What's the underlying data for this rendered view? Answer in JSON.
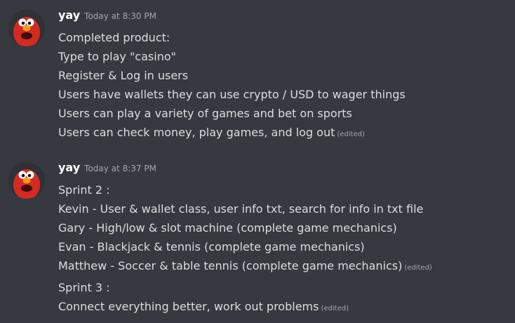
{
  "colors": {
    "background": "#36393f",
    "text": "#dcddde",
    "username": "#ffffff",
    "muted": "#a3a6aa",
    "avatar_red": "#d42a21"
  },
  "messages": [
    {
      "avatar_icon": "elmo-avatar",
      "username": "yay",
      "timestamp": "Today at 8:30 PM",
      "lines": [
        "Completed product:",
        "Type to play \"casino\"",
        "Register & Log in users",
        "Users have wallets they can use crypto / USD to wager things",
        "Users can play a variety of games and bet on sports",
        "Users can check money, play games, and log out"
      ],
      "edited_label": "(edited)"
    },
    {
      "avatar_icon": "elmo-avatar",
      "username": "yay",
      "timestamp": "Today at 8:37 PM",
      "lines": [
        "Sprint 2 :",
        "Kevin - User & wallet class, user info txt, search for info in txt file",
        "Gary - High/low & slot machine (complete game mechanics)",
        "Evan - Blackjack & tennis (complete game mechanics)",
        "Matthew - Soccer & table tennis (complete game mechanics)"
      ],
      "edited_label": "(edited)",
      "followup_lines": [
        "Sprint 3 :",
        "Connect everything better, work out problems"
      ],
      "followup_edited_label": "(edited)"
    }
  ]
}
